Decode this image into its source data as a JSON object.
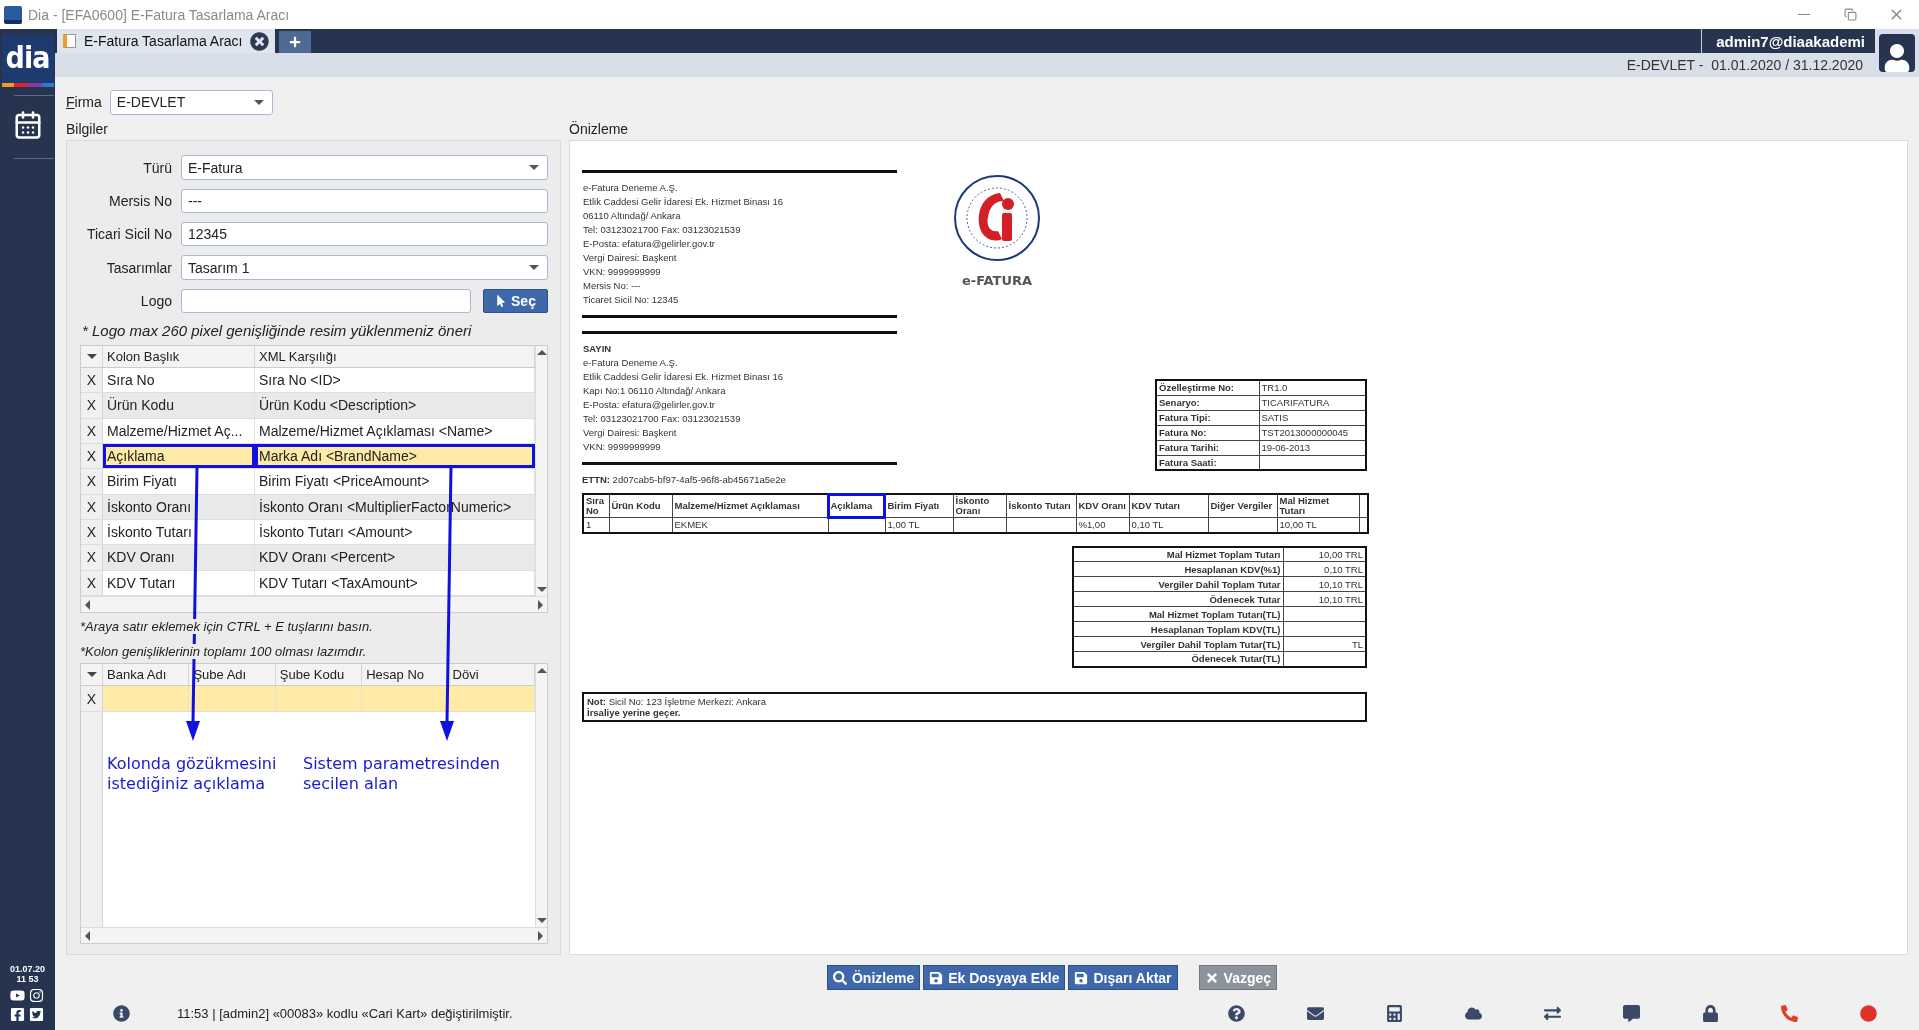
{
  "title_bar": {
    "title": "Dia - [EFA0600] E-Fatura Tasarlama Aracı"
  },
  "sidebar": {
    "brand": "dia",
    "date": "01.07.20",
    "time": "11 53"
  },
  "tabs": [
    {
      "label": "E-Fatura Tasarlama Aracı",
      "selected": true
    }
  ],
  "user": {
    "name": "admin7@diaakademi",
    "period": "E-DEVLET -  01.01.2020 / 31.12.2020"
  },
  "firma": {
    "label": "Firma",
    "value": "E-DEVLET"
  },
  "bilgiler": {
    "title": "Bilgiler",
    "fields": [
      {
        "label": "Türü",
        "value": "E-Fatura",
        "kind": "combo"
      },
      {
        "label": "Mersis No",
        "value": "---",
        "kind": "text"
      },
      {
        "label": "Ticari Sicil No",
        "value": "12345",
        "kind": "text"
      },
      {
        "label": "Tasarımlar",
        "value": "Tasarım 1",
        "kind": "combo"
      },
      {
        "label": "Logo",
        "kind": "file",
        "button": "Seç"
      }
    ],
    "logo_note": "* Logo max 260 pixel genişliğinde resim yüklenmeniz öneri",
    "column_grid": {
      "columns": [
        "Kolon Başlık",
        "XML Karşılığı"
      ],
      "rows": [
        {
          "marker": "X",
          "title": "Sıra No",
          "xml": "Sıra No <ID>",
          "selected": false,
          "boxed": false
        },
        {
          "marker": "X",
          "title": "Ürün Kodu",
          "xml": "Ürün Kodu <Description>",
          "selected": false,
          "boxed": false
        },
        {
          "marker": "X",
          "title": "Malzeme/Hizmet Aç...",
          "xml": "Malzeme/Hizmet Açıklaması <Name>",
          "selected": false,
          "boxed": false
        },
        {
          "marker": "X",
          "title": "Açıklama",
          "xml": "Marka Adı <BrandName>",
          "selected": true,
          "boxed": true
        },
        {
          "marker": "X",
          "title": "Birim Fiyatı",
          "xml": "Birim Fiyatı <PriceAmount>",
          "selected": false,
          "boxed": false
        },
        {
          "marker": "X",
          "title": "İskonto Oranı",
          "xml": "İskonto Oranı <MultiplierFactorNumeric>",
          "selected": false,
          "boxed": false
        },
        {
          "marker": "X",
          "title": "İskonto Tutarı",
          "xml": "İskonto Tutarı <Amount>",
          "selected": false,
          "boxed": false
        },
        {
          "marker": "X",
          "title": "KDV Oranı",
          "xml": "KDV Oranı <Percent>",
          "selected": false,
          "boxed": false
        },
        {
          "marker": "X",
          "title": "KDV Tutarı",
          "xml": "KDV Tutarı <TaxAmount>",
          "selected": false,
          "boxed": false
        }
      ]
    },
    "notes": [
      "*Araya satır eklemek için CTRL + E tuşlarını basın.",
      "*Kolon genişliklerinin toplamı 100 olması lazımdır."
    ],
    "bank_grid": {
      "columns": [
        "Banka Adı",
        "Şube Adı",
        "Şube Kodu",
        "Hesap No",
        "Dövi"
      ],
      "rows": [
        {
          "marker": "X",
          "selected": true
        }
      ]
    },
    "annotations": [
      {
        "text": "Kolonda gözükmesini istediğiniz açıklama"
      },
      {
        "text": "Sistem parametresinden secilen alan"
      }
    ]
  },
  "preview": {
    "title": "Önizleme",
    "sender": [
      "e-Fatura Deneme A.Ş.",
      "Etlik Caddesi Gelir İdaresi Ek. Hizmet Binası 16",
      "06110 Altındağ/ Ankara",
      "Tel: 03123021700 Fax: 03123021539",
      "E-Posta: efatura@gelirler.gov.tr",
      "Vergi Dairesi: Başkent",
      "VKN: 9999999999",
      "Mersis No: ---",
      "Ticaret Sicil No: 12345"
    ],
    "logo_caption": "e-FATURA",
    "receiver": {
      "heading": "SAYIN",
      "lines": [
        "e-Fatura Deneme A.Ş.",
        "Etlik Caddesi Gelir İdaresi Ek. Hizmet Binası 16",
        "Kapı No:1 06110 Altındağ/ Ankara",
        "E-Posta: efatura@gelirler.gov.tr",
        "Tel: 03123021700 Fax: 03123021539",
        "Vergi Dairesi: Başkent",
        "VKN: 9999999999"
      ]
    },
    "ettn": "**ETTN:** 2d07cab5-bf97-4af5-96f8-ab45671a5e2e",
    "info": [
      {
        "label": "Özelleştirme No:",
        "value": "TR1.0"
      },
      {
        "label": "Senaryo:",
        "value": "TICARIFATURA"
      },
      {
        "label": "Fatura Tipi:",
        "value": "SATIS"
      },
      {
        "label": "Fatura No:",
        "value": "TST2013000000045"
      },
      {
        "label": "Fatura Tarihi:",
        "value": "19-06-2013"
      },
      {
        "label": "Fatura Saati:"
      }
    ],
    "items": {
      "columns": [
        {
          "label": "Sıra No",
          "boxed": false
        },
        {
          "label": "Ürün Kodu",
          "boxed": false
        },
        {
          "label": "Malzeme/Hizmet Açıklaması",
          "boxed": false
        },
        {
          "label": "Açıklama",
          "boxed": true
        },
        {
          "label": "Birim Fiyatı",
          "boxed": false
        },
        {
          "label": "İskonto Oranı",
          "boxed": false
        },
        {
          "label": "İskonto Tutarı",
          "boxed": false
        },
        {
          "label": "KDV Oranı",
          "boxed": false
        },
        {
          "label": "KDV Tutarı",
          "boxed": false
        },
        {
          "label": "Diğer Vergiler",
          "boxed": false
        },
        {
          "label": "Mal Hizmet Tutarı",
          "boxed": false
        }
      ],
      "rows": [
        [
          "1",
          null,
          "EKMEK",
          null,
          "1,00 TL",
          null,
          null,
          "%1,00",
          "0,10 TL",
          null,
          "10,00 TL"
        ]
      ]
    },
    "totals": [
      {
        "label": "Mal Hizmet Toplam Tutarı",
        "value": "10,00 TRL"
      },
      {
        "label": "Hesaplanan KDV(%1)",
        "value": "0,10 TRL"
      },
      {
        "label": "Vergiler Dahil Toplam Tutar",
        "value": "10,10 TRL"
      },
      {
        "label": "Ödenecek Tutar",
        "value": "10,10 TRL"
      },
      {
        "label": "Mal Hizmet Toplam Tutarı(TL)"
      },
      {
        "label": "Hesaplanan Toplam KDV(TL)"
      },
      {
        "label": "Vergiler Dahil Toplam Tutar(TL)",
        "value": "TL"
      },
      {
        "label": "Ödenecek Tutar(TL)"
      }
    ],
    "note": [
      "**Not:** Sicil No: 123 İşletme Merkezi: Ankara",
      "İrsaliye yerine geçer."
    ]
  },
  "buttons": [
    {
      "label": "Önizleme",
      "kind": "preview"
    },
    {
      "label": "Ek Dosyaya Ekle",
      "kind": "attach"
    },
    {
      "label": "Dışarı Aktar",
      "kind": "export"
    },
    {
      "label": "Vazgeç",
      "kind": "cancel"
    }
  ],
  "status_bar": {
    "message": "11:53 | [admin2] «00083» kodlu «Cari Kart» değiştirilmiştir."
  }
}
